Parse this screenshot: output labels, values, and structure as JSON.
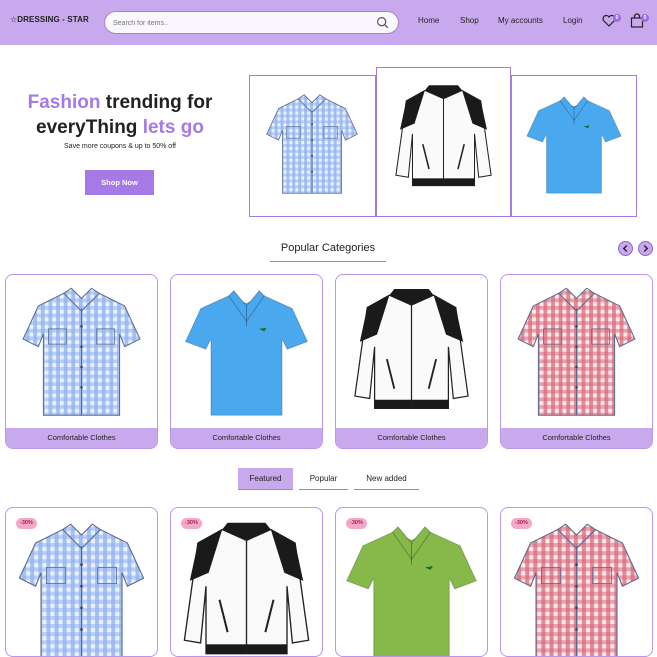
{
  "header": {
    "logo": "☆DRESSING - STAR",
    "search_placeholder": "Search for items..",
    "nav": [
      "Home",
      "Shop",
      "My accounts",
      "Login"
    ],
    "wishlist_count": "0",
    "cart_count": "0"
  },
  "hero": {
    "line1_accent": "Fashion",
    "line1_rest": " trending for",
    "line2_rest": "everyThing ",
    "line2_accent": "lets go",
    "subtitle": "Save more coupons & up to 50% off",
    "button": "Shop Now"
  },
  "categories": {
    "title": "Popular Categories",
    "items": [
      {
        "label": "Comfortable Clothes",
        "icon": "blue-gingham-shirt"
      },
      {
        "label": "Comfortable Clothes",
        "icon": "blue-polo-shirt"
      },
      {
        "label": "Comfortable Clothes",
        "icon": "white-black-jacket"
      },
      {
        "label": "Comfortable Clothes",
        "icon": "red-gingham-shirt"
      }
    ]
  },
  "tabs": [
    "Featured",
    "Popular",
    "New added"
  ],
  "products": [
    {
      "badge": "-30%",
      "icon": "blue-gingham-shirt"
    },
    {
      "badge": "-30%",
      "icon": "white-black-jacket"
    },
    {
      "badge": "-30%",
      "icon": "green-polo-shirt"
    },
    {
      "badge": "-30%",
      "icon": "red-gingham-shirt"
    }
  ],
  "colors": {
    "accent": "#a57ae6",
    "header_bg": "#c9a9ee",
    "badge_bg": "#f2a9c7",
    "badge_text": "#b0194b"
  }
}
